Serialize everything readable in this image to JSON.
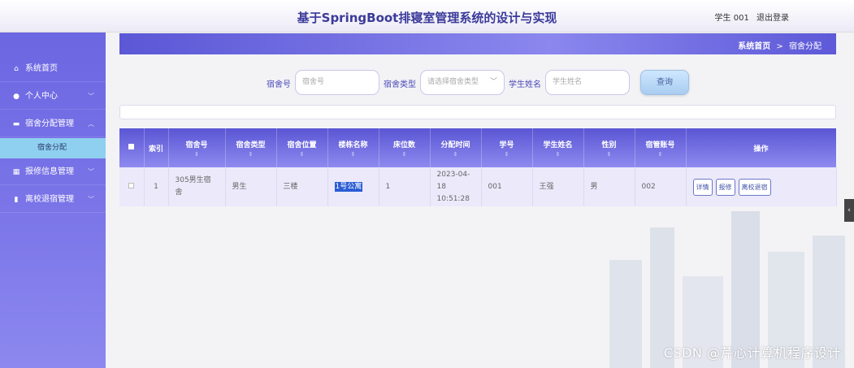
{
  "header": {
    "title": "基于SpringBoot排寝室管理系统的设计与实现",
    "user": "学生 001",
    "logout": "退出登录"
  },
  "sidebar": {
    "items": [
      {
        "label": "系统首页",
        "icon": "home-icon"
      },
      {
        "label": "个人中心",
        "icon": "user-icon"
      },
      {
        "label": "宿舍分配管理",
        "icon": "bed-icon"
      },
      {
        "label": "报修信息管理",
        "icon": "grid-icon"
      },
      {
        "label": "离校退宿管理",
        "icon": "document-icon"
      }
    ],
    "sub_item": "宿舍分配"
  },
  "breadcrumb": {
    "home": "系统首页",
    "sep": ">",
    "current": "宿舍分配"
  },
  "search": {
    "room_label": "宿舍号",
    "room_placeholder": "宿舍号",
    "type_label": "宿舍类型",
    "type_placeholder": "请选择宿舍类型",
    "student_label": "学生姓名",
    "student_placeholder": "学生姓名",
    "query_button": "查询"
  },
  "table": {
    "headers": [
      "索引",
      "宿舍号",
      "宿舍类型",
      "宿舍位置",
      "楼栋名称",
      "床位数",
      "分配时间",
      "学号",
      "学生姓名",
      "性别",
      "宿管账号",
      "操作"
    ],
    "rows": [
      {
        "index": "1",
        "room": "305男生宿舍",
        "type": "男生",
        "location": "三楼",
        "building": "1号公寓",
        "beds": "1",
        "time": "2023-04-18 10:51:28",
        "student_no": "001",
        "student_name": "王强",
        "gender": "男",
        "manager": "002"
      }
    ],
    "actions": [
      "详情",
      "报修",
      "离校退宿"
    ]
  },
  "watermark": "CSDN @芹心计算机程序设计",
  "colors": {
    "accent": "#6c67e2",
    "header_text": "#3b3a9a",
    "sub_highlight": "#8fd0f0"
  }
}
